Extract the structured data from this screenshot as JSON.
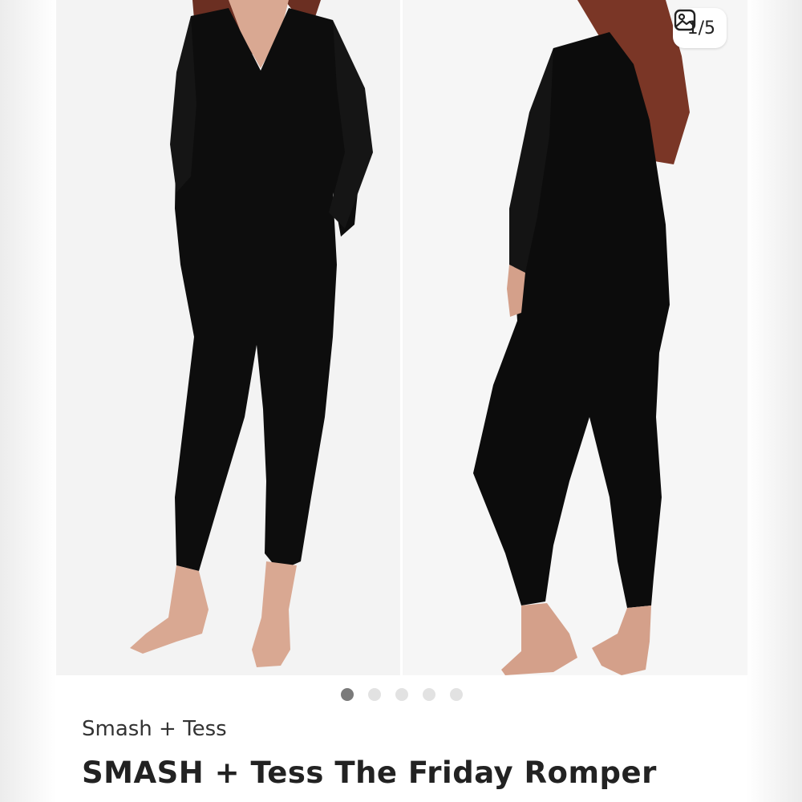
{
  "gallery": {
    "counter": "1/5",
    "icon": "gallery-icon",
    "dots_count": 5,
    "active_index": 0
  },
  "listing": {
    "brand": "Smash + Tess",
    "title": "SMASH + Tess The Friday Romper"
  }
}
